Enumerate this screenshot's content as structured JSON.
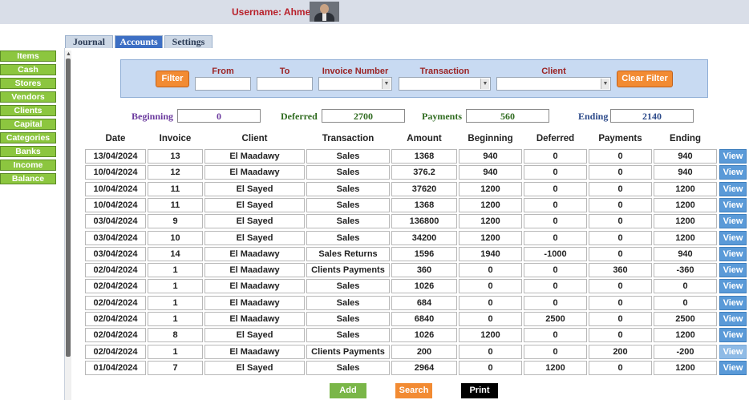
{
  "header": {
    "username_label": "Username: Ahmed"
  },
  "sidebar": {
    "items": [
      "Items",
      "Cash",
      "Stores",
      "Vendors",
      "Clients",
      "Capital",
      "Categories",
      "Banks",
      "Income",
      "Balance"
    ]
  },
  "tabs": [
    "Journal",
    "Accounts",
    "Settings"
  ],
  "filter": {
    "filter_label": "Filter",
    "clear_label": "Clear Filter",
    "from_label": "From",
    "to_label": "To",
    "invoice_label": "Invoice Number",
    "transaction_label": "Transaction",
    "client_label": "Client"
  },
  "totals": {
    "beginning_label": "Beginning",
    "beginning_value": "0",
    "deferred_label": "Deferred",
    "deferred_value": "2700",
    "payments_label": "Payments",
    "payments_value": "560",
    "ending_label": "Ending",
    "ending_value": "2140",
    "beginning_color": "#6b3a9e",
    "deferred_color": "#2f6b1f",
    "payments_color": "#2f6b1f",
    "ending_color": "#2c4a8a"
  },
  "table": {
    "headers": [
      "Date",
      "Invoice",
      "Client",
      "Transaction",
      "Amount",
      "Beginning",
      "Deferred",
      "Payments",
      "Ending"
    ],
    "view_label": "View",
    "rows": [
      [
        "13/04/2024",
        "13",
        "El Maadawy",
        "Sales",
        "1368",
        "940",
        "0",
        "0",
        "940"
      ],
      [
        "10/04/2024",
        "12",
        "El Maadawy",
        "Sales",
        "376.2",
        "940",
        "0",
        "0",
        "940"
      ],
      [
        "10/04/2024",
        "11",
        "El Sayed",
        "Sales",
        "37620",
        "1200",
        "0",
        "0",
        "1200"
      ],
      [
        "10/04/2024",
        "11",
        "El Sayed",
        "Sales",
        "1368",
        "1200",
        "0",
        "0",
        "1200"
      ],
      [
        "03/04/2024",
        "9",
        "El Sayed",
        "Sales",
        "136800",
        "1200",
        "0",
        "0",
        "1200"
      ],
      [
        "03/04/2024",
        "10",
        "El Sayed",
        "Sales",
        "34200",
        "1200",
        "0",
        "0",
        "1200"
      ],
      [
        "03/04/2024",
        "14",
        "El Maadawy",
        "Sales Returns",
        "1596",
        "1940",
        "-1000",
        "0",
        "940"
      ],
      [
        "02/04/2024",
        "1",
        "El Maadawy",
        "Clients Payments",
        "360",
        "0",
        "0",
        "360",
        "-360"
      ],
      [
        "02/04/2024",
        "1",
        "El Maadawy",
        "Sales",
        "1026",
        "0",
        "0",
        "0",
        "0"
      ],
      [
        "02/04/2024",
        "1",
        "El Maadawy",
        "Sales",
        "684",
        "0",
        "0",
        "0",
        "0"
      ],
      [
        "02/04/2024",
        "1",
        "El Maadawy",
        "Sales",
        "6840",
        "0",
        "2500",
        "0",
        "2500"
      ],
      [
        "02/04/2024",
        "8",
        "El Sayed",
        "Sales",
        "1026",
        "1200",
        "0",
        "0",
        "1200"
      ],
      [
        "02/04/2024",
        "1",
        "El Maadawy",
        "Clients Payments",
        "200",
        "0",
        "0",
        "200",
        "-200"
      ],
      [
        "01/04/2024",
        "7",
        "El Sayed",
        "Sales",
        "2964",
        "0",
        "1200",
        "0",
        "1200"
      ]
    ]
  },
  "actions": {
    "add_label": "Add",
    "search_label": "Search",
    "print_label": "Print"
  },
  "colors": {
    "accent": "#3d6fc4",
    "sidebar_green": "#8cc63f",
    "filter_orange": "#f28b33",
    "view_blue": "#5a9ad8"
  }
}
